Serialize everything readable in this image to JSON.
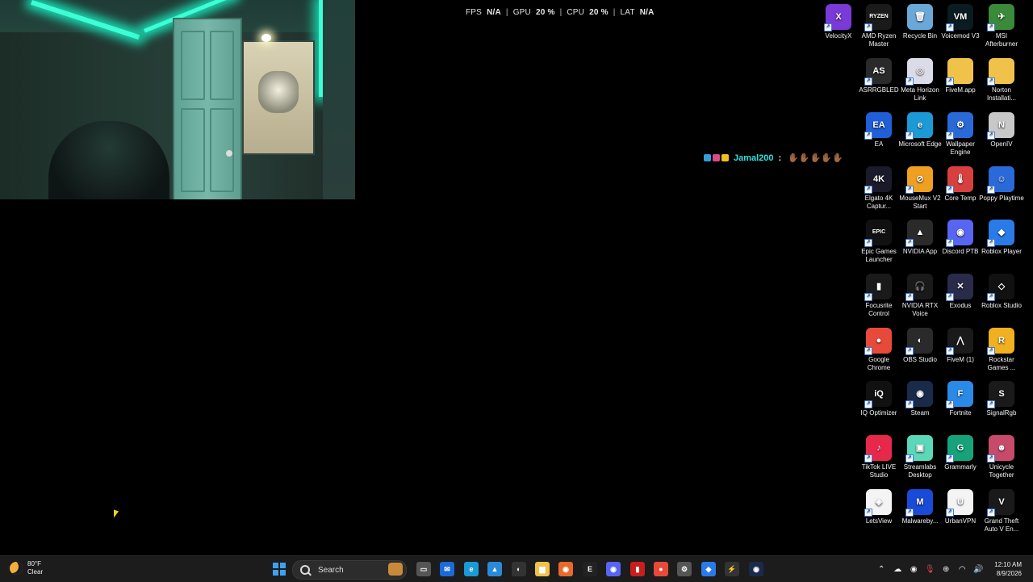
{
  "hud": {
    "fps_label": "FPS",
    "fps_value": "N/A",
    "gpu_label": "GPU",
    "gpu_value": "20 %",
    "cpu_label": "CPU",
    "cpu_value": "20 %",
    "lat_label": "LAT",
    "lat_value": "N/A",
    "separator": "|"
  },
  "chat": {
    "username": "Jamal200",
    "colon": ":",
    "message": "✋🏾✋🏾✋🏾✋🏾✋🏾"
  },
  "desktop_icons": [
    {
      "label": "VelocityX",
      "icon": "velocityx-icon",
      "color": "#7a3ad8",
      "glyph": "X"
    },
    {
      "label": "AMD Ryzen Master",
      "icon": "amd-ryzen-icon",
      "color": "#1a1a1a",
      "glyph": "RYZEN"
    },
    {
      "label": "Recycle Bin",
      "icon": "recycle-bin-icon",
      "color": "#6aa8d8",
      "glyph": "🗑"
    },
    {
      "label": "Voicemod V3",
      "icon": "voicemod-icon",
      "color": "#0b1b22",
      "glyph": "VM"
    },
    {
      "label": "MSI Afterburner",
      "icon": "msi-afterburner-icon",
      "color": "#3a8a3a",
      "glyph": "✈"
    },
    {
      "label": "ASRRGBLED",
      "icon": "asrock-rgb-icon",
      "color": "#2a2a2a",
      "glyph": "AS"
    },
    {
      "label": "Meta Horizon Link",
      "icon": "meta-horizon-icon",
      "color": "#dcdce8",
      "glyph": "◎"
    },
    {
      "label": "FiveM.app",
      "icon": "folder-icon",
      "color": "#f0c24a",
      "glyph": ""
    },
    {
      "label": "Norton Installati...",
      "icon": "folder-icon",
      "color": "#f0c24a",
      "glyph": ""
    },
    {
      "label": "EA",
      "icon": "ea-icon",
      "color": "#1f5fd8",
      "glyph": "EA"
    },
    {
      "label": "Microsoft Edge",
      "icon": "edge-icon",
      "color": "#1b9ad6",
      "glyph": "e"
    },
    {
      "label": "Wallpaper Engine",
      "icon": "wallpaper-engine-icon",
      "color": "#2a6ad8",
      "glyph": "⚙"
    },
    {
      "label": "OpenIV",
      "icon": "openiv-icon",
      "color": "#c8c8c8",
      "glyph": "N"
    },
    {
      "label": "Elgato 4K Captur...",
      "icon": "elgato-icon",
      "color": "#1a1a2a",
      "glyph": "4K"
    },
    {
      "label": "MouseMux V2 Start",
      "icon": "mousemux-icon",
      "color": "#f0a020",
      "glyph": "⊘"
    },
    {
      "label": "Core Temp",
      "icon": "core-temp-icon",
      "color": "#d84040",
      "glyph": "🌡"
    },
    {
      "label": "Poppy Playtime",
      "icon": "poppy-playtime-icon",
      "color": "#2a6ad8",
      "glyph": "☺"
    },
    {
      "label": "Epic Games Launcher",
      "icon": "epic-games-icon",
      "color": "#111111",
      "glyph": "EPIC"
    },
    {
      "label": "NVIDIA App",
      "icon": "nvidia-icon",
      "color": "#2a2a2a",
      "glyph": "▲"
    },
    {
      "label": "Discord PTB",
      "icon": "discord-icon",
      "color": "#5865f2",
      "glyph": "◉"
    },
    {
      "label": "Roblox Player",
      "icon": "roblox-icon",
      "color": "#2a7ae8",
      "glyph": "◆"
    },
    {
      "label": "Focusrite Control",
      "icon": "focusrite-icon",
      "color": "#1a1a1a",
      "glyph": "▮"
    },
    {
      "label": "NVIDIA RTX Voice",
      "icon": "rtx-voice-icon",
      "color": "#1a1a1a",
      "glyph": "🎧"
    },
    {
      "label": "Exodus",
      "icon": "exodus-icon",
      "color": "#2a2a4a",
      "glyph": "✕"
    },
    {
      "label": "Roblox Studio",
      "icon": "roblox-studio-icon",
      "color": "#111111",
      "glyph": "◇"
    },
    {
      "label": "Google Chrome",
      "icon": "chrome-icon",
      "color": "#e84a3a",
      "glyph": "●"
    },
    {
      "label": "OBS Studio",
      "icon": "obs-icon",
      "color": "#2a2a2a",
      "glyph": "◐"
    },
    {
      "label": "FiveM (1)",
      "icon": "fivem-icon",
      "color": "#1a1a1a",
      "glyph": "⋀"
    },
    {
      "label": "Rockstar Games ...",
      "icon": "rockstar-icon",
      "color": "#f0b020",
      "glyph": "R"
    },
    {
      "label": "IQ Optimizer",
      "icon": "iq-optimizer-icon",
      "color": "#111111",
      "glyph": "iQ"
    },
    {
      "label": "Steam",
      "icon": "steam-icon",
      "color": "#1a2a4a",
      "glyph": "◉"
    },
    {
      "label": "Fortnite",
      "icon": "fortnite-icon",
      "color": "#2a8ae8",
      "glyph": "F"
    },
    {
      "label": "SignalRgb",
      "icon": "signalrgb-icon",
      "color": "#1a1a1a",
      "glyph": "S"
    },
    {
      "label": "TikTok LIVE Studio",
      "icon": "tiktok-icon",
      "color": "#e8284a",
      "glyph": "♪"
    },
    {
      "label": "Streamlabs Desktop",
      "icon": "streamlabs-icon",
      "color": "#5ad8b8",
      "glyph": "▣"
    },
    {
      "label": "Grammarly",
      "icon": "grammarly-icon",
      "color": "#16a37c",
      "glyph": "G"
    },
    {
      "label": "Unicycle Together",
      "icon": "unicycle-icon",
      "color": "#c84a6a",
      "glyph": "☻"
    },
    {
      "label": "LetsView",
      "icon": "letsview-icon",
      "color": "#f4f4f4",
      "glyph": "◈"
    },
    {
      "label": "Malwareby...",
      "icon": "malwarebytes-icon",
      "color": "#1a4ad8",
      "glyph": "M"
    },
    {
      "label": "UrbanVPN",
      "icon": "urbanvpn-icon",
      "color": "#f4f4f4",
      "glyph": "U"
    },
    {
      "label": "Grand Theft Auto V En...",
      "icon": "gta-v-icon",
      "color": "#1a1a1a",
      "glyph": "V"
    }
  ],
  "taskbar": {
    "weather_temp": "80°F",
    "weather_cond": "Clear",
    "search_placeholder": "Search",
    "apps": [
      {
        "name": "task-view-icon",
        "color": "#555555",
        "glyph": "▭"
      },
      {
        "name": "outlook-icon",
        "color": "#1a6ad8",
        "glyph": "✉"
      },
      {
        "name": "edge-taskbar-icon",
        "color": "#1b9ad6",
        "glyph": "e"
      },
      {
        "name": "photos-icon",
        "color": "#2a8ad8",
        "glyph": "▲"
      },
      {
        "name": "obs-taskbar-icon",
        "color": "#333333",
        "glyph": "◐"
      },
      {
        "name": "file-explorer-icon",
        "color": "#f0c24a",
        "glyph": "▆"
      },
      {
        "name": "firefox-icon",
        "color": "#e86a2a",
        "glyph": "◉"
      },
      {
        "name": "epic-taskbar-icon",
        "color": "#222222",
        "glyph": "E"
      },
      {
        "name": "discord-taskbar-icon",
        "color": "#5865f2",
        "glyph": "◉"
      },
      {
        "name": "red-app-icon",
        "color": "#c81e1e",
        "glyph": "▮"
      },
      {
        "name": "chrome-taskbar-icon",
        "color": "#e84a3a",
        "glyph": "●"
      },
      {
        "name": "settings-icon",
        "color": "#555555",
        "glyph": "⚙"
      },
      {
        "name": "roblox-taskbar-icon",
        "color": "#2a7ae8",
        "glyph": "◆"
      },
      {
        "name": "power-app-icon",
        "color": "#333333",
        "glyph": "⚡"
      },
      {
        "name": "steam-taskbar-icon",
        "color": "#1a2a4a",
        "glyph": "◉"
      }
    ],
    "time": "12:10 AM",
    "date": "8/9/2026"
  },
  "colors": {
    "led": "#3cffd6",
    "chat_user": "#2ee0e0",
    "taskbar": "#1c1c1c"
  }
}
